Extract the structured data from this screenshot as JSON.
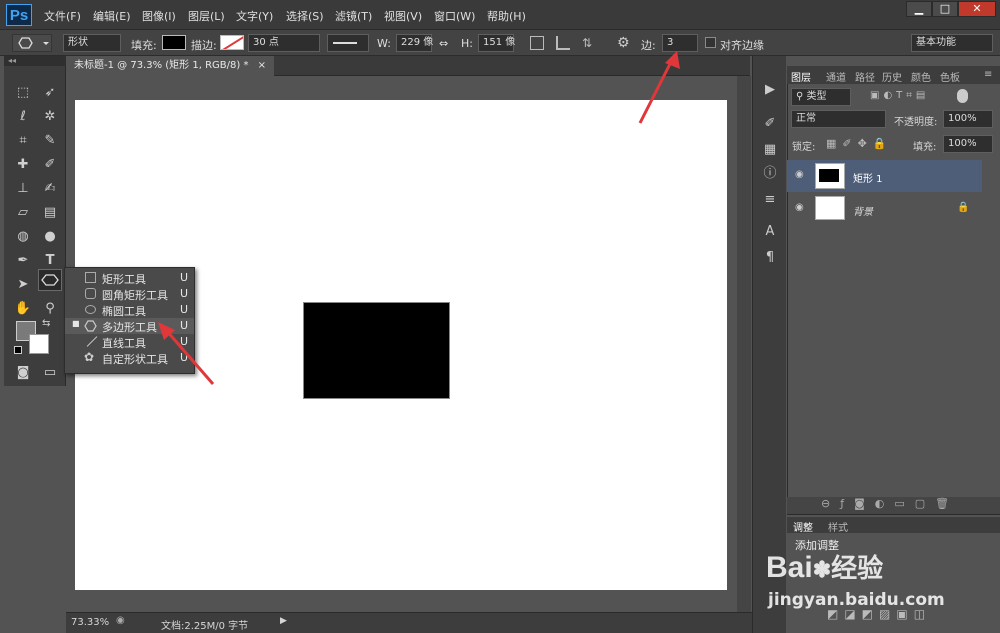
{
  "app": {
    "logo": "Ps"
  },
  "menu": [
    "文件(F)",
    "编辑(E)",
    "图像(I)",
    "图层(L)",
    "文字(Y)",
    "选择(S)",
    "滤镜(T)",
    "视图(V)",
    "窗口(W)",
    "帮助(H)"
  ],
  "window_controls": {
    "minimize": "▁",
    "restore": "□",
    "close": "✕"
  },
  "options": {
    "mode": "形状",
    "fill_label": "填充:",
    "stroke_label": "描边:",
    "stroke_width": "30 点",
    "w_label": "W:",
    "w_value": "229 像",
    "link_glyph": "⇔",
    "h_label": "H:",
    "h_value": "151 像",
    "sides_label": "边:",
    "sides_value": "3",
    "align_edges_label": "对齐边缘",
    "workspace": "基本功能"
  },
  "document_tab": {
    "title": "未标题-1 @ 73.3% (矩形 1, RGB/8) *",
    "close": "×"
  },
  "flyout": {
    "items": [
      {
        "label": "矩形工具",
        "key": "U",
        "icon": "rectangle-icon",
        "selected": false
      },
      {
        "label": "圆角矩形工具",
        "key": "U",
        "icon": "rounded-rectangle-icon",
        "selected": false
      },
      {
        "label": "椭圆工具",
        "key": "U",
        "icon": "ellipse-icon",
        "selected": false
      },
      {
        "label": "多边形工具",
        "key": "U",
        "icon": "polygon-icon",
        "selected": true
      },
      {
        "label": "直线工具",
        "key": "U",
        "icon": "line-icon",
        "selected": false
      },
      {
        "label": "自定形状工具",
        "key": "U",
        "icon": "custom-shape-icon",
        "selected": false
      }
    ]
  },
  "status": {
    "zoom": "73.33%",
    "doc_info": "文档:2.25M/0 字节"
  },
  "layers_panel": {
    "tabs": [
      "图层",
      "通道",
      "路径",
      "历史",
      "颜色",
      "色板"
    ],
    "filter": "类型",
    "blend_mode": "正常",
    "opacity_label": "不透明度:",
    "opacity_value": "100%",
    "lock_label": "锁定:",
    "fill_label": "填充:",
    "fill_value": "100%",
    "layers": [
      {
        "name": "矩形 1",
        "selected": true
      },
      {
        "name": "背景",
        "selected": false
      }
    ]
  },
  "adjust_panel": {
    "tabs": [
      "调整",
      "样式"
    ],
    "title": "添加调整"
  },
  "watermark": {
    "brand": "Bai",
    "brand_cn": "经验",
    "url": "jingyan.baidu.com"
  },
  "colors": {
    "accent_red": "#e0373a",
    "panel_bg": "#535353",
    "selected_layer": "#4e5e78"
  }
}
